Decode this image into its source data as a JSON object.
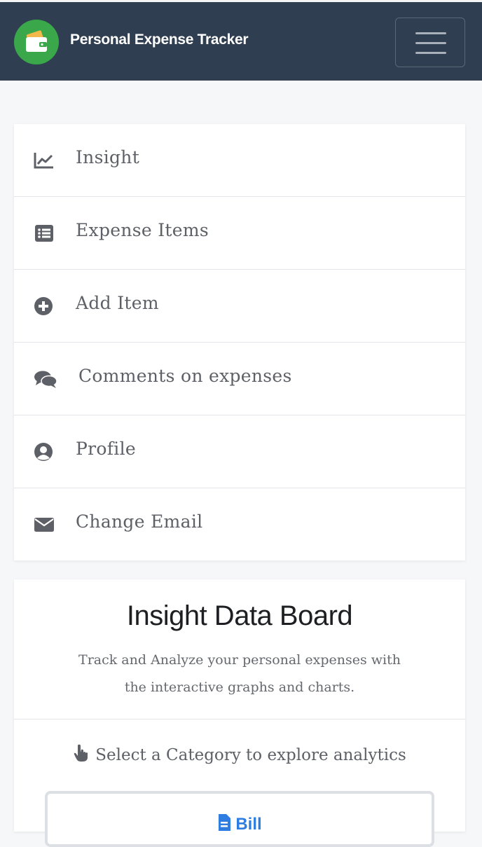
{
  "navbar": {
    "brand": "Personal Expense Tracker",
    "logo_icon": "wallet-icon",
    "toggle_icon": "hamburger-menu-icon",
    "bg_color": "#2f3e50",
    "logo_color": "#3aa84a"
  },
  "menu": {
    "items": [
      {
        "label": "Insight",
        "icon": "chart-line-icon"
      },
      {
        "label": "Expense Items",
        "icon": "list-alt-icon"
      },
      {
        "label": "Add Item",
        "icon": "plus-circle-icon"
      },
      {
        "label": "Comments on expenses",
        "icon": "comments-icon"
      },
      {
        "label": "Profile",
        "icon": "user-circle-icon"
      },
      {
        "label": "Change Email",
        "icon": "envelope-icon"
      }
    ]
  },
  "insight": {
    "title": "Insight Data Board",
    "description": "Track and Analyze your personal expenses with the interactive graphs and charts.",
    "select_prompt": "Select a Category to explore analytics",
    "select_icon": "hand-pointer-icon",
    "category_label": "Bill",
    "category_icon": "file-invoice-icon",
    "accent_color": "#2f7de1"
  }
}
